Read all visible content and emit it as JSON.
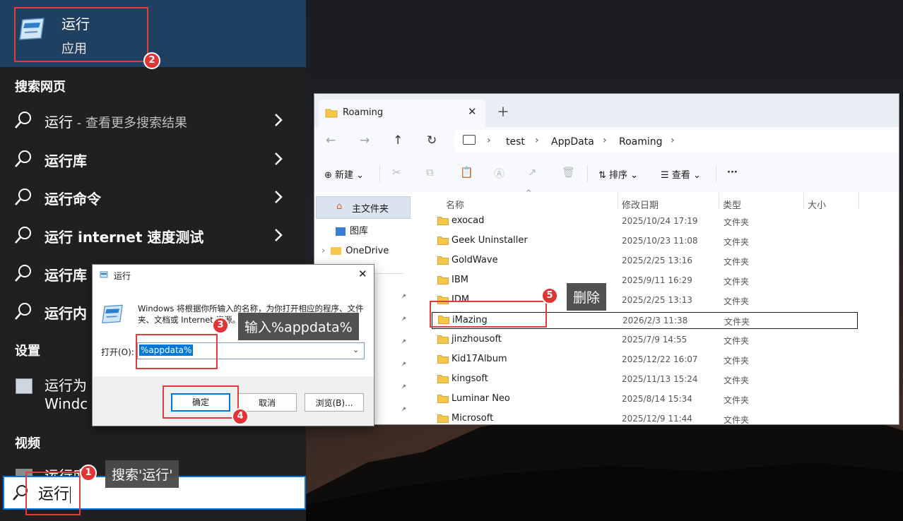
{
  "start": {
    "best_match": {
      "title": "运行",
      "subtitle": "应用"
    },
    "sections": {
      "web": "搜索网页",
      "settings": "设置",
      "videos": "视频"
    },
    "web_results": [
      {
        "main": "运行",
        "suffix": " - 查看更多搜索结果"
      },
      {
        "main": "运行库",
        "suffix": ""
      },
      {
        "main": "运行命令",
        "suffix": ""
      },
      {
        "main": "运行 internet 速度测试",
        "suffix": ""
      },
      {
        "main": "运行库",
        "suffix": ""
      },
      {
        "main": "运行内",
        "suffix": ""
      }
    ],
    "setting_item": {
      "line1": "运行为",
      "line2": "Windc"
    },
    "video_item": "运行库... 运行后勿",
    "search": {
      "value": "运行"
    }
  },
  "explorer": {
    "tab_title": "Roaming",
    "breadcrumbs": [
      "test",
      "AppData",
      "Roaming"
    ],
    "toolbar": {
      "new_label": "新建",
      "sort_label": "排序",
      "view_label": "查看",
      "more": "···"
    },
    "sidebar": {
      "home": "主文件夹",
      "gallery": "图库",
      "onedrive": "OneDrive"
    },
    "columns": {
      "name": "名称",
      "modified": "修改日期",
      "type": "类型",
      "size": "大小"
    },
    "files": [
      {
        "name": "exocad",
        "date": "2025/10/24 17:19",
        "type": "文件夹"
      },
      {
        "name": "Geek Uninstaller",
        "date": "2025/10/23 11:08",
        "type": "文件夹"
      },
      {
        "name": "GoldWave",
        "date": "2025/2/25 13:16",
        "type": "文件夹"
      },
      {
        "name": "IBM",
        "date": "2025/9/11 16:29",
        "type": "文件夹"
      },
      {
        "name": "IDM",
        "date": "2025/2/25 13:13",
        "type": "文件夹"
      },
      {
        "name": "iMazing",
        "date": "2026/2/3 11:38",
        "type": "文件夹"
      },
      {
        "name": "jinzhousoft",
        "date": "2025/7/9 14:55",
        "type": "文件夹"
      },
      {
        "name": "Kid17Album",
        "date": "2025/12/22 16:07",
        "type": "文件夹"
      },
      {
        "name": "kingsoft",
        "date": "2025/11/13 15:24",
        "type": "文件夹"
      },
      {
        "name": "Luminar Neo",
        "date": "2025/8/14 15:34",
        "type": "文件夹"
      },
      {
        "name": "Microsoft",
        "date": "2025/12/9 11:44",
        "type": "文件夹"
      }
    ]
  },
  "run_dialog": {
    "title": "运行",
    "description": "Windows 将根据你所输入的名称，为你打开相应的程序、文件夹、文档或 Internet 资源。",
    "open_label": "打开(O):",
    "input_value": "%appdata%",
    "ok": "确定",
    "cancel": "取消",
    "browse": "浏览(B)..."
  },
  "annotations": {
    "badges": [
      "1",
      "2",
      "3",
      "4",
      "5"
    ],
    "labels": {
      "step1": "搜索'运行'",
      "step3": "输入%appdata%",
      "step5": "删除"
    }
  },
  "colors": {
    "accent": "#0078d7",
    "annotation_red": "#e13434",
    "start_bg": "#202023",
    "best_match_bg": "#1f4060"
  }
}
